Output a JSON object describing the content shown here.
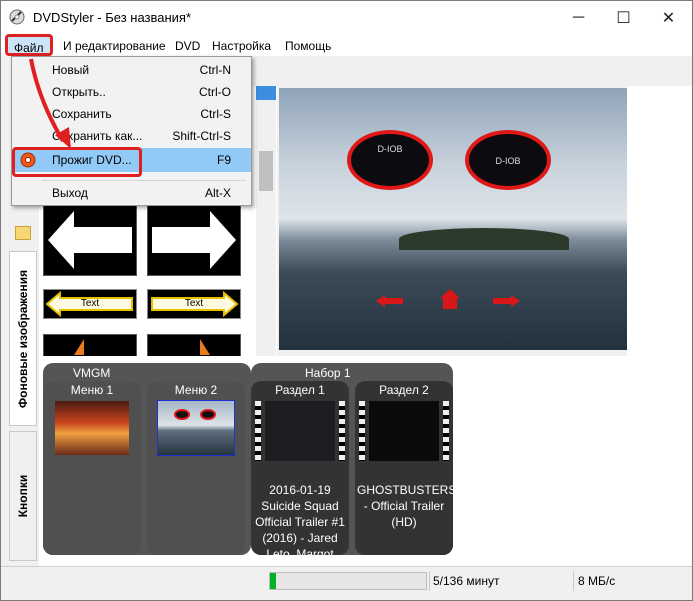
{
  "window": {
    "title": "DVDStyler - Без названия*",
    "minimize": "─",
    "maximize": "☐",
    "close": "✕"
  },
  "menubar": {
    "items": [
      "Файл",
      "И редактирование",
      "DVD",
      "Настройка",
      "Помощь"
    ]
  },
  "file_menu": {
    "items": [
      {
        "label": "Новый",
        "shortcut": "Ctrl-N"
      },
      {
        "label": "Открыть..",
        "shortcut": "Ctrl-O"
      },
      {
        "label": "Сохранить",
        "shortcut": "Ctrl-S"
      },
      {
        "label": "Сохранить как...",
        "shortcut": "Shift-Ctrl-S"
      },
      {
        "label": "Прожиг DVD...",
        "shortcut": "F9"
      },
      {
        "label": "Выход",
        "shortcut": "Alt-X"
      }
    ]
  },
  "side_tabs": {
    "backgrounds": "Фоновые изображения",
    "buttons": "Кнопки"
  },
  "thumbnails": {
    "text_button_label": "Text"
  },
  "preview": {
    "oval_left_text": "D-IOB",
    "oval_right_text": "D-IOB"
  },
  "titleset": {
    "vmgm_label": "VMGM",
    "set_label": "Набор 1",
    "menu1": "Меню 1",
    "menu2": "Меню 2",
    "chapter1": "Раздел 1",
    "chapter2": "Раздел 2",
    "chapter1_text": "2016-01-19 Suicide Squad Official Trailer #1 (2016) - Jared Leto, Margot Robbie Movie HD",
    "chapter2_text": "GHOSTBUSTERS - Official Trailer (HD)"
  },
  "status": {
    "progress_fraction": 0.04,
    "duration": "5/136 минут",
    "rate": "8 МБ/с"
  },
  "colors": {
    "highlight_red": "#e02020",
    "progress_green": "#06b025"
  }
}
